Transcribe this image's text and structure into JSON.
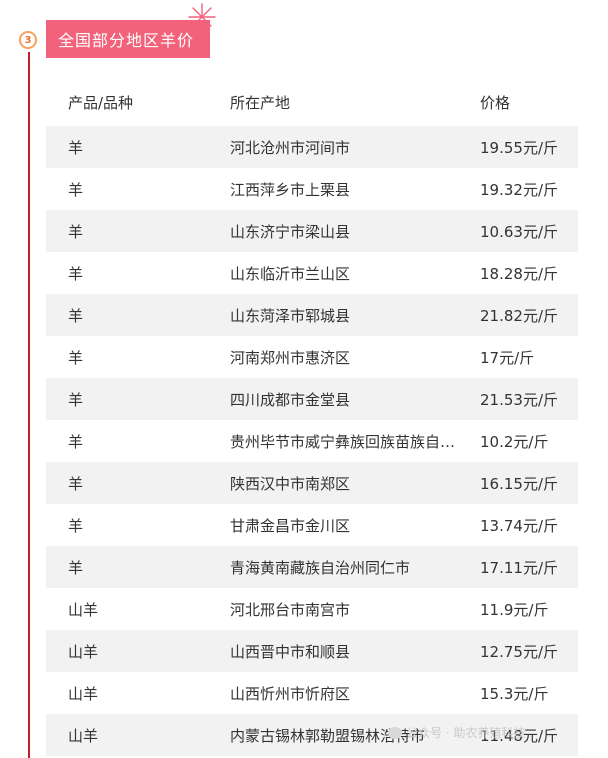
{
  "section": {
    "number": "3",
    "title": "全国部分地区羊价"
  },
  "table": {
    "headers": [
      "产品/品种",
      "所在产地",
      "价格"
    ],
    "rows": [
      [
        "羊",
        "河北沧州市河间市",
        "19.55元/斤"
      ],
      [
        "羊",
        "江西萍乡市上栗县",
        "19.32元/斤"
      ],
      [
        "羊",
        "山东济宁市梁山县",
        "10.63元/斤"
      ],
      [
        "羊",
        "山东临沂市兰山区",
        "18.28元/斤"
      ],
      [
        "羊",
        "山东菏泽市郓城县",
        "21.82元/斤"
      ],
      [
        "羊",
        "河南郑州市惠济区",
        "17元/斤"
      ],
      [
        "羊",
        "四川成都市金堂县",
        "21.53元/斤"
      ],
      [
        "羊",
        "贵州毕节市威宁彝族回族苗族自…",
        "10.2元/斤"
      ],
      [
        "羊",
        "陕西汉中市南郑区",
        "16.15元/斤"
      ],
      [
        "羊",
        "甘肃金昌市金川区",
        "13.74元/斤"
      ],
      [
        "羊",
        "青海黄南藏族自治州同仁市",
        "17.11元/斤"
      ],
      [
        "山羊",
        "河北邢台市南宫市",
        "11.9元/斤"
      ],
      [
        "山羊",
        "山西晋中市和顺县",
        "12.75元/斤"
      ],
      [
        "山羊",
        "山西忻州市忻府区",
        "15.3元/斤"
      ],
      [
        "山羊",
        "内蒙古锡林郭勒盟锡林浩特市",
        "11.48元/斤"
      ]
    ]
  },
  "watermark": {
    "text": "公众号 · 助农养殖科技"
  },
  "colors": {
    "accent": "#f2627a",
    "timeline": "#c41d2a",
    "circle": "#f5a35a",
    "stripe": "#f2f2f2"
  }
}
